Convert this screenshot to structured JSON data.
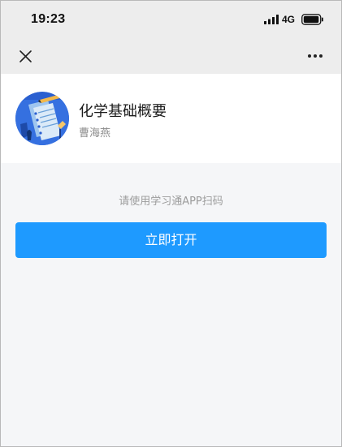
{
  "status_bar": {
    "time": "19:23",
    "network": "4G"
  },
  "nav": {
    "close_icon": "close-icon",
    "more_icon": "more-icon"
  },
  "course": {
    "title": "化学基础概要",
    "teacher": "曹海燕",
    "avatar_icon": "book-notebook-illustration"
  },
  "hint": "请使用学习通APP扫码",
  "open_button_label": "立即打开",
  "colors": {
    "primary": "#1E9AFF",
    "background": "#F5F6F8",
    "header": "#EDEDED"
  }
}
